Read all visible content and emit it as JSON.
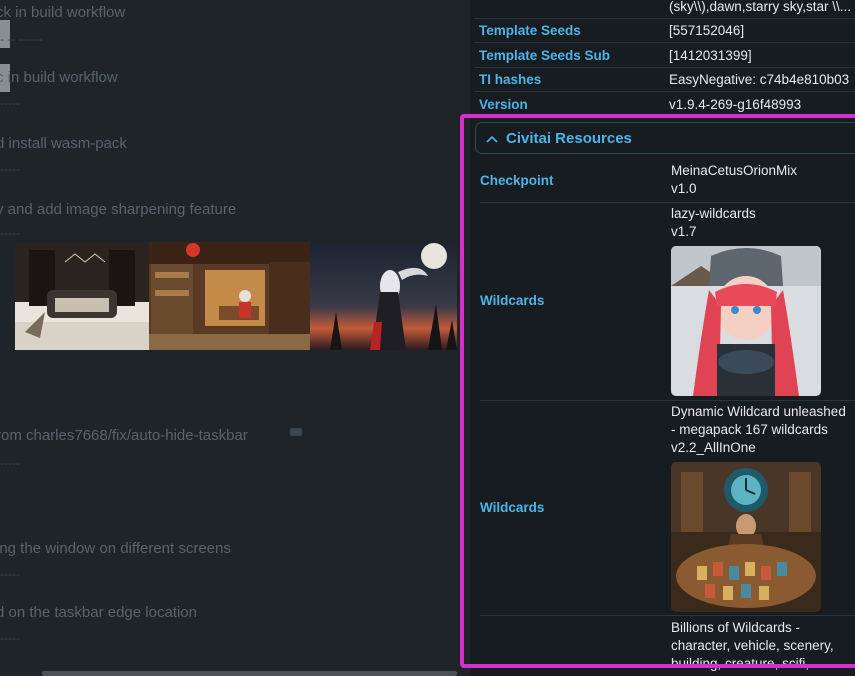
{
  "left_panel": {
    "commits": [
      {
        "title": "ck in build workflow",
        "meta": "-- -- ------"
      },
      {
        "title": "c in build workflow",
        "meta": "------"
      },
      {
        "title": "d install wasm-pack",
        "meta": "------"
      },
      {
        "title": "y and add image sharpening feature",
        "meta": "------"
      },
      {
        "title": "rom charles7668/fix/auto-hide-taskbar",
        "meta": "------"
      },
      {
        "title": "ing the window on different screens",
        "meta": "------"
      },
      {
        "title": "d on the taskbar edge location",
        "meta": "------"
      }
    ]
  },
  "metadata": {
    "rows": [
      {
        "key": "",
        "value": "(sky\\\\),dawn,starry sky,star \\\\..."
      },
      {
        "key": "Template Seeds",
        "value": "[557152046]"
      },
      {
        "key": "Template Seeds Sub",
        "value": "[1412031399]"
      },
      {
        "key": "TI hashes",
        "value": "EasyNegative: c74b4e810b03"
      },
      {
        "key": "Version",
        "value": "v1.9.4-269-g16f48993"
      }
    ]
  },
  "civitai": {
    "title": "Civitai Resources",
    "resources": [
      {
        "label": "Checkpoint",
        "lines": [
          "MeinaCetusOrionMix",
          "v1.0"
        ]
      },
      {
        "label": "Wildcards",
        "lines": [
          "lazy-wildcards",
          "v1.7"
        ]
      },
      {
        "label": "Wildcards",
        "lines": [
          "Dynamic Wildcard unleashed",
          "- megapack 167 wildcards",
          "v2.2_AllInOne"
        ]
      },
      {
        "label": "",
        "lines": [
          "Billions of Wildcards -",
          "character, vehicle, scenery,",
          "building, creature, scifi,"
        ]
      }
    ]
  },
  "colors": {
    "accent": "#4fb3e8",
    "highlight_border": "#d62fd0",
    "panel_bg": "#171c21",
    "page_bg": "#1f2429"
  }
}
